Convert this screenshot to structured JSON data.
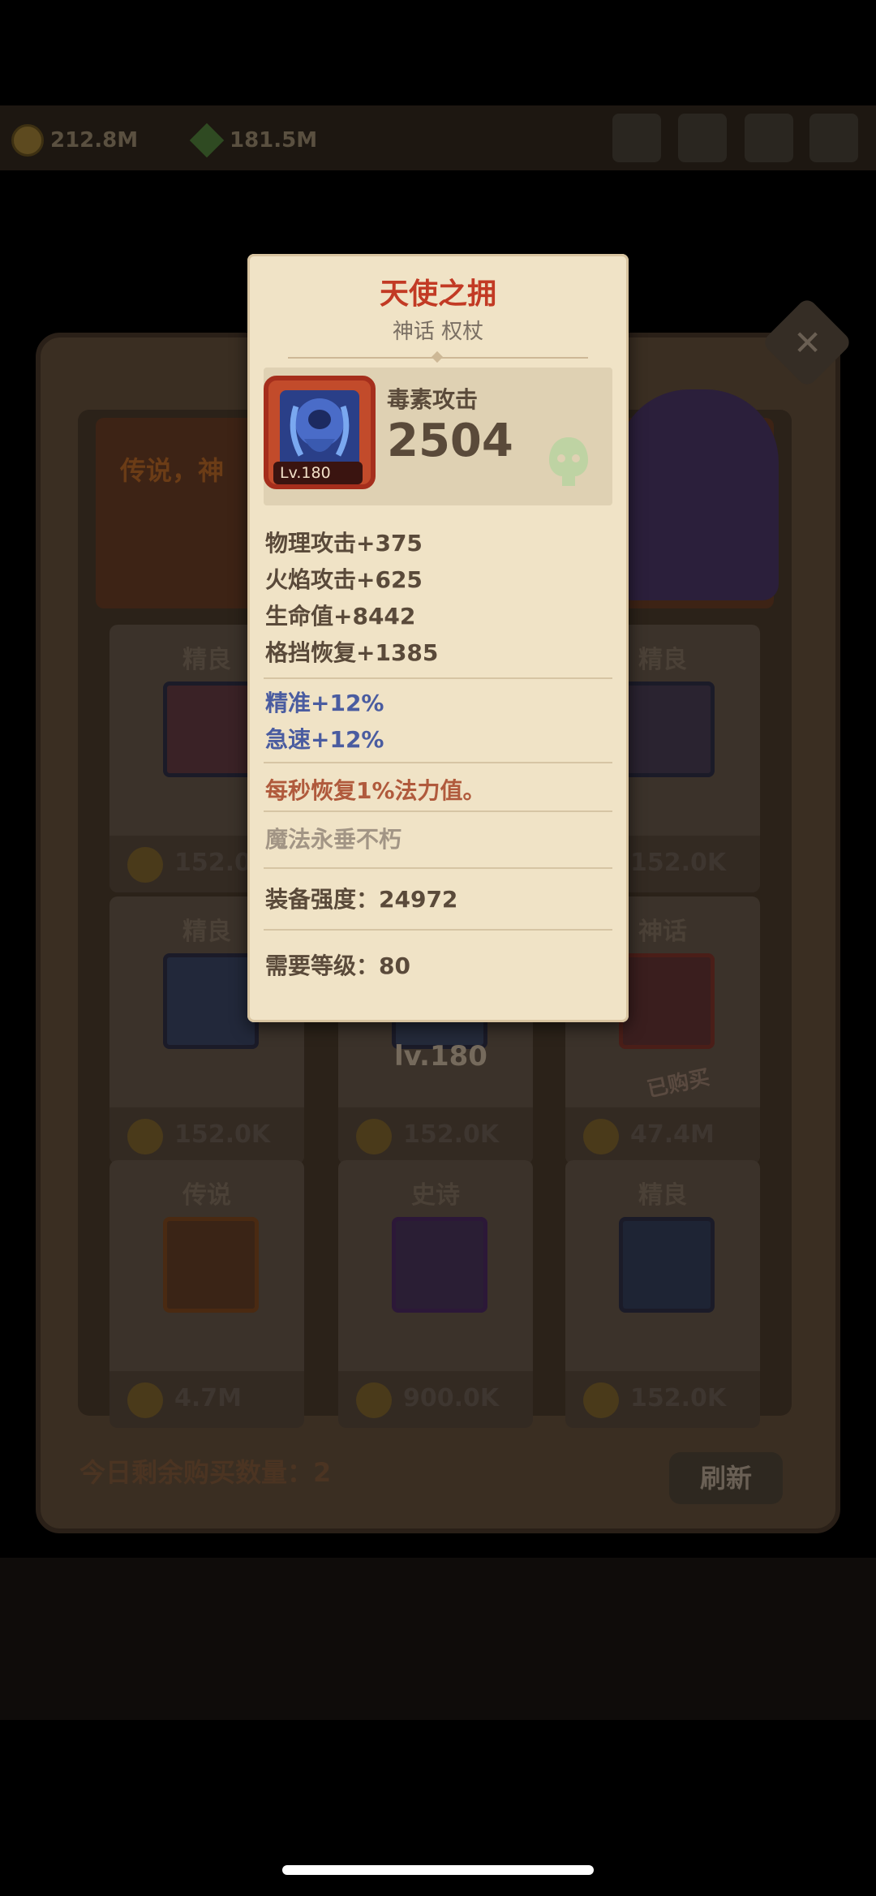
{
  "background": {
    "currencies": [
      "212.8M",
      "181.5M"
    ],
    "banner_text": "传说，神",
    "shop_items": [
      {
        "rarity": "精良",
        "price": "152.0K"
      },
      {
        "rarity": "",
        "price": ""
      },
      {
        "rarity": "精良",
        "price": "152.0K"
      },
      {
        "rarity": "精良",
        "price": "152.0K"
      },
      {
        "rarity": "",
        "price": "152.0K"
      },
      {
        "rarity": "神话",
        "price": "47.4M"
      },
      {
        "rarity": "传说",
        "price": "4.7M"
      },
      {
        "rarity": "史诗",
        "price": "900.0K"
      },
      {
        "rarity": "精良",
        "price": "152.0K"
      }
    ],
    "card_level_label": "lv.180",
    "bought_label": "已购买",
    "remaining_label": "今日剩余购买数量：2",
    "refresh_label": "刷新"
  },
  "tooltip": {
    "title": "天使之拥",
    "subtitle": "神话 权杖",
    "level_badge": "Lv.180",
    "main_stat_label": "毒素攻击",
    "main_stat_value": "2504",
    "base_stats": [
      "物理攻击+375",
      "火焰攻击+625",
      "生命值+8442",
      "格挡恢复+1385"
    ],
    "bonus_stats": [
      "精准+12%",
      "急速+12%"
    ],
    "special_effect": "每秒恢复1%法力值。",
    "flavor_text": "魔法永垂不朽",
    "gear_score": "装备强度：24972",
    "required_level": "需要等级：80"
  },
  "colors": {
    "title_red": "#c23a24",
    "bonus_blue": "#4a5ca0",
    "effect_orange": "#b05a3c",
    "parchment": "#f0e3c6"
  }
}
